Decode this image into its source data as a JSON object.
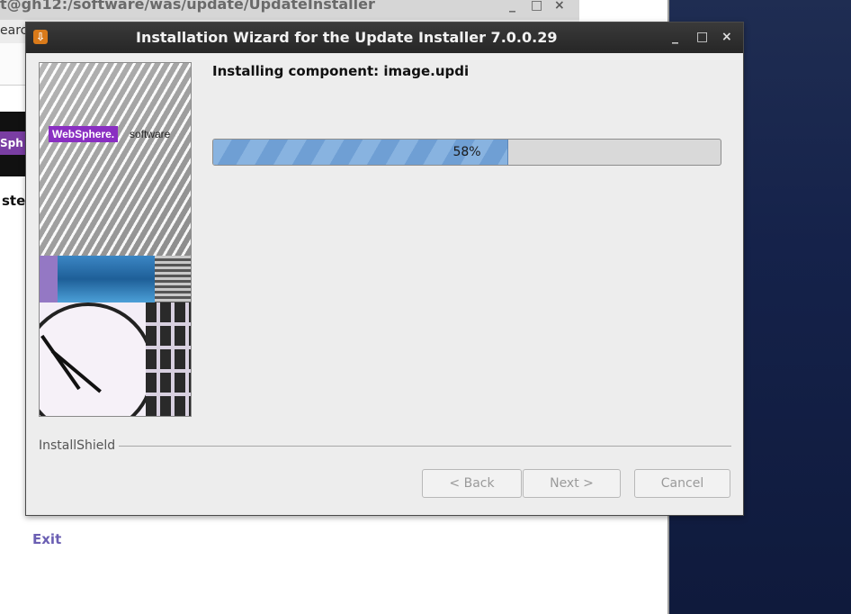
{
  "background_window": {
    "title": "t@gh12:/software/was/update/UpdateInstaller",
    "title_controls": [
      "_",
      "□",
      "×"
    ],
    "menu_fragment": "earc",
    "banner_fragment": "Sph",
    "step_fragment": "ste",
    "exit_label": "Exit"
  },
  "dialog": {
    "title": "Installation Wizard for the Update Installer 7.0.0.29",
    "title_controls": [
      "_",
      "□",
      "×"
    ],
    "status_text": "Installing component: image.updi",
    "progress": {
      "value_percent": 58,
      "label": "58%"
    },
    "side_image": {
      "brand": "WebSphere.",
      "brand_suffix": "software"
    },
    "brand_label": "InstallShield",
    "buttons": {
      "back": "< Back",
      "next": "Next >",
      "cancel": "Cancel"
    }
  },
  "colors": {
    "accent_purple": "#8a2fc2",
    "progress_fill": "#88b3e0",
    "dialog_titlebar": "#2f2f2f",
    "desktop": "#15224a"
  },
  "icons": {
    "app_icon": "installer-icon",
    "minimize": "minimize-icon",
    "maximize": "maximize-icon",
    "close": "close-icon"
  }
}
